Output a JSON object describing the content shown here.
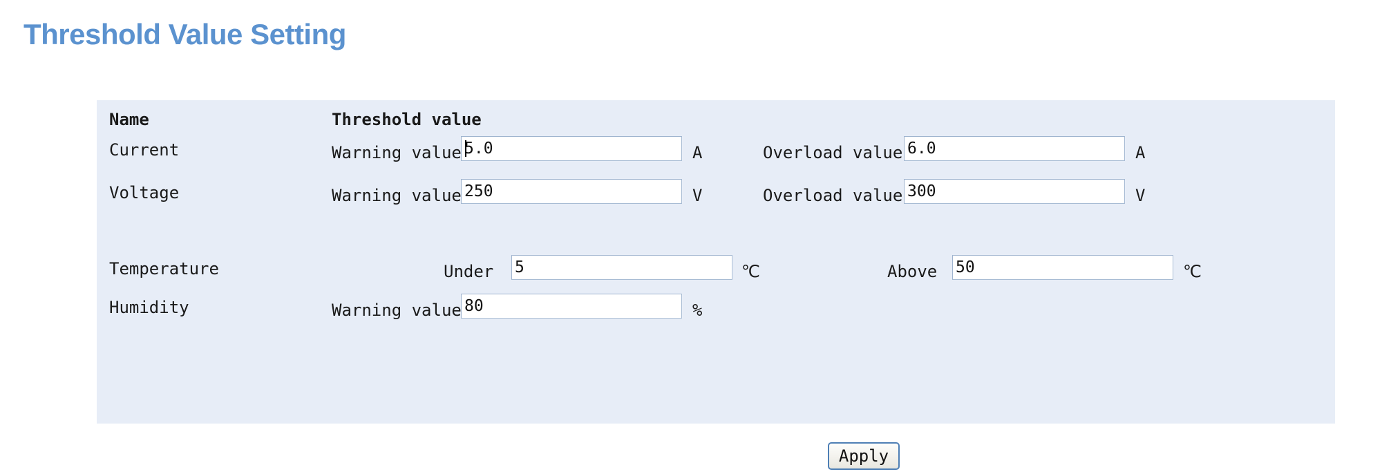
{
  "page": {
    "title": "Threshold Value Setting",
    "title_color": "#5b92cf",
    "panel_background": "#e7edf7"
  },
  "table": {
    "headers": {
      "name": "Name",
      "threshold_value": "Threshold value"
    },
    "rows": [
      {
        "name": "Current",
        "left_label": "Warning value",
        "left_value": "5.0",
        "left_unit": "A",
        "right_label": "Overload value",
        "right_value": "6.0",
        "right_unit": "A"
      },
      {
        "name": "Voltage",
        "left_label": "Warning value",
        "left_value": "250",
        "left_unit": "V",
        "right_label": "Overload value",
        "right_value": "300",
        "right_unit": "V"
      },
      {
        "name": "Temperature",
        "left_label": "Under",
        "left_value": "5",
        "left_unit": "℃",
        "right_label": "Above",
        "right_value": "50",
        "right_unit": "℃"
      },
      {
        "name": "Humidity",
        "left_label": "Warning value",
        "left_value": "80",
        "left_unit": "%",
        "right_label": "",
        "right_value": "",
        "right_unit": ""
      }
    ]
  },
  "actions": {
    "apply_label": "Apply"
  }
}
